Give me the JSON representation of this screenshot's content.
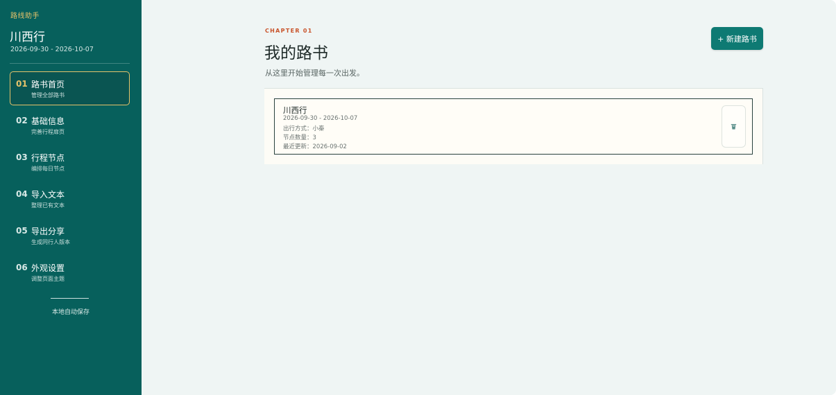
{
  "sidebar": {
    "brand": "路线助手",
    "trip_title": "川西行",
    "trip_dates": "2026-09-30 - 2026-10-07",
    "items": [
      {
        "num": "01",
        "label": "路书首页",
        "sub": "管理全部路书",
        "active": true
      },
      {
        "num": "02",
        "label": "基础信息",
        "sub": "完善行程扉页"
      },
      {
        "num": "03",
        "label": "行程节点",
        "sub": "编排每日节点"
      },
      {
        "num": "04",
        "label": "导入文本",
        "sub": "整理已有文本"
      },
      {
        "num": "05",
        "label": "导出分享",
        "sub": "生成同行人版本"
      },
      {
        "num": "06",
        "label": "外观设置",
        "sub": "调整页面主题"
      }
    ],
    "save_status": "本地自动保存"
  },
  "main": {
    "eyebrow": "CHAPTER 01",
    "title": "我的路书",
    "description": "从这里开始管理每一次出发。",
    "new_button": "+ 新建路书",
    "cards": [
      {
        "title": "川西行",
        "dates": "2026-09-30 - 2026-10-07",
        "mode": "出行方式：小秦",
        "nodes": "节点数量：3",
        "updated": "最近更新：2026-09-02",
        "delete_icon": "trash-icon"
      }
    ]
  },
  "colors": {
    "sidebar_bg": "#07605c",
    "accent_gold": "#e6c26a",
    "eyebrow": "#c9532a",
    "primary_button": "#0e7a73",
    "page_bg": "#eff5f4"
  }
}
